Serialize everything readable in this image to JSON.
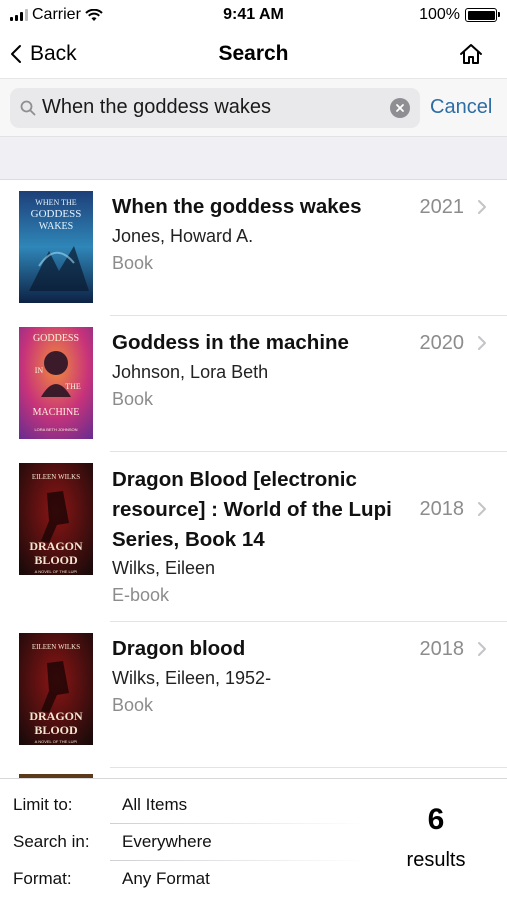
{
  "status_bar": {
    "carrier": "Carrier",
    "time": "9:41 AM",
    "battery": "100%"
  },
  "nav": {
    "back_label": "Back",
    "title": "Search",
    "home_icon": "home-icon"
  },
  "search": {
    "query": "When the goddess wakes",
    "cancel_label": "Cancel"
  },
  "results": [
    {
      "title_lines": [
        "When the goddess wakes"
      ],
      "author": "Jones, Howard A.",
      "format": "Book",
      "year": "2021"
    },
    {
      "title_lines": [
        "Goddess in the machine"
      ],
      "author": "Johnson, Lora Beth",
      "format": "Book",
      "year": "2020"
    },
    {
      "title_lines": [
        "Dragon Blood [electronic",
        "resource] : World of the Lupi",
        "Series, Book 14"
      ],
      "author": "Wilks, Eileen",
      "format": "E-book",
      "year": "2018"
    },
    {
      "title_lines": [
        "Dragon blood"
      ],
      "author": "Wilks, Eileen, 1952-",
      "format": "Book",
      "year": "2018"
    }
  ],
  "covers": [
    {
      "lines": [
        "WHEN THE",
        "GODDESS",
        "WAKES"
      ],
      "colors": [
        "#1d3f78",
        "#2f86b8",
        "#0d2244"
      ]
    },
    {
      "lines": [
        "GODDESS",
        "IN",
        "THE",
        "MACHINE",
        "LORA BETH JOHNSON"
      ],
      "colors": [
        "#c8337a",
        "#f08a3c",
        "#6a2d8f"
      ]
    },
    {
      "lines": [
        "EILEEN WILKS",
        "DRAGON",
        "BLOOD",
        "A NOVEL OF THE LUPI"
      ],
      "colors": [
        "#1a0a0a",
        "#8c1515",
        "#2a0505"
      ]
    },
    {
      "lines": [
        "EILEEN WILKS",
        "DRAGON",
        "BLOOD",
        "A NOVEL OF THE LUPI"
      ],
      "colors": [
        "#1a0a0a",
        "#8c1515",
        "#2a0505"
      ]
    }
  ],
  "filters": [
    {
      "label": "Limit to:",
      "value": "All Items"
    },
    {
      "label": "Search in:",
      "value": "Everywhere"
    },
    {
      "label": "Format:",
      "value": "Any Format"
    }
  ],
  "summary": {
    "count": "6",
    "label": "results"
  },
  "colors": {
    "accent": "#2e6da4",
    "secondary_text": "#8c8c8c"
  }
}
